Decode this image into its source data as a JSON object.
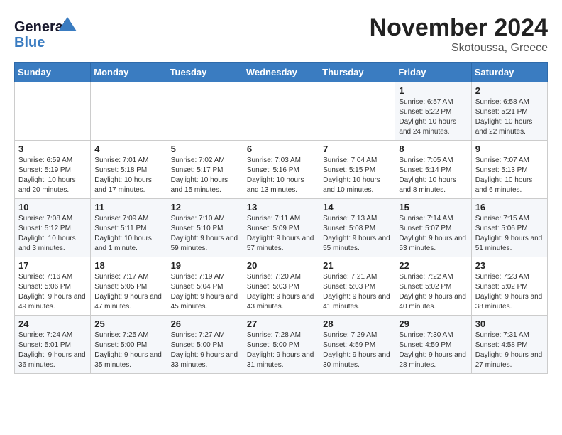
{
  "header": {
    "logo_line1": "General",
    "logo_line2": "Blue",
    "month": "November 2024",
    "location": "Skotoussa, Greece"
  },
  "weekdays": [
    "Sunday",
    "Monday",
    "Tuesday",
    "Wednesday",
    "Thursday",
    "Friday",
    "Saturday"
  ],
  "weeks": [
    [
      {
        "day": "",
        "info": ""
      },
      {
        "day": "",
        "info": ""
      },
      {
        "day": "",
        "info": ""
      },
      {
        "day": "",
        "info": ""
      },
      {
        "day": "",
        "info": ""
      },
      {
        "day": "1",
        "info": "Sunrise: 6:57 AM\nSunset: 5:22 PM\nDaylight: 10 hours and 24 minutes."
      },
      {
        "day": "2",
        "info": "Sunrise: 6:58 AM\nSunset: 5:21 PM\nDaylight: 10 hours and 22 minutes."
      }
    ],
    [
      {
        "day": "3",
        "info": "Sunrise: 6:59 AM\nSunset: 5:19 PM\nDaylight: 10 hours and 20 minutes."
      },
      {
        "day": "4",
        "info": "Sunrise: 7:01 AM\nSunset: 5:18 PM\nDaylight: 10 hours and 17 minutes."
      },
      {
        "day": "5",
        "info": "Sunrise: 7:02 AM\nSunset: 5:17 PM\nDaylight: 10 hours and 15 minutes."
      },
      {
        "day": "6",
        "info": "Sunrise: 7:03 AM\nSunset: 5:16 PM\nDaylight: 10 hours and 13 minutes."
      },
      {
        "day": "7",
        "info": "Sunrise: 7:04 AM\nSunset: 5:15 PM\nDaylight: 10 hours and 10 minutes."
      },
      {
        "day": "8",
        "info": "Sunrise: 7:05 AM\nSunset: 5:14 PM\nDaylight: 10 hours and 8 minutes."
      },
      {
        "day": "9",
        "info": "Sunrise: 7:07 AM\nSunset: 5:13 PM\nDaylight: 10 hours and 6 minutes."
      }
    ],
    [
      {
        "day": "10",
        "info": "Sunrise: 7:08 AM\nSunset: 5:12 PM\nDaylight: 10 hours and 3 minutes."
      },
      {
        "day": "11",
        "info": "Sunrise: 7:09 AM\nSunset: 5:11 PM\nDaylight: 10 hours and 1 minute."
      },
      {
        "day": "12",
        "info": "Sunrise: 7:10 AM\nSunset: 5:10 PM\nDaylight: 9 hours and 59 minutes."
      },
      {
        "day": "13",
        "info": "Sunrise: 7:11 AM\nSunset: 5:09 PM\nDaylight: 9 hours and 57 minutes."
      },
      {
        "day": "14",
        "info": "Sunrise: 7:13 AM\nSunset: 5:08 PM\nDaylight: 9 hours and 55 minutes."
      },
      {
        "day": "15",
        "info": "Sunrise: 7:14 AM\nSunset: 5:07 PM\nDaylight: 9 hours and 53 minutes."
      },
      {
        "day": "16",
        "info": "Sunrise: 7:15 AM\nSunset: 5:06 PM\nDaylight: 9 hours and 51 minutes."
      }
    ],
    [
      {
        "day": "17",
        "info": "Sunrise: 7:16 AM\nSunset: 5:06 PM\nDaylight: 9 hours and 49 minutes."
      },
      {
        "day": "18",
        "info": "Sunrise: 7:17 AM\nSunset: 5:05 PM\nDaylight: 9 hours and 47 minutes."
      },
      {
        "day": "19",
        "info": "Sunrise: 7:19 AM\nSunset: 5:04 PM\nDaylight: 9 hours and 45 minutes."
      },
      {
        "day": "20",
        "info": "Sunrise: 7:20 AM\nSunset: 5:03 PM\nDaylight: 9 hours and 43 minutes."
      },
      {
        "day": "21",
        "info": "Sunrise: 7:21 AM\nSunset: 5:03 PM\nDaylight: 9 hours and 41 minutes."
      },
      {
        "day": "22",
        "info": "Sunrise: 7:22 AM\nSunset: 5:02 PM\nDaylight: 9 hours and 40 minutes."
      },
      {
        "day": "23",
        "info": "Sunrise: 7:23 AM\nSunset: 5:02 PM\nDaylight: 9 hours and 38 minutes."
      }
    ],
    [
      {
        "day": "24",
        "info": "Sunrise: 7:24 AM\nSunset: 5:01 PM\nDaylight: 9 hours and 36 minutes."
      },
      {
        "day": "25",
        "info": "Sunrise: 7:25 AM\nSunset: 5:00 PM\nDaylight: 9 hours and 35 minutes."
      },
      {
        "day": "26",
        "info": "Sunrise: 7:27 AM\nSunset: 5:00 PM\nDaylight: 9 hours and 33 minutes."
      },
      {
        "day": "27",
        "info": "Sunrise: 7:28 AM\nSunset: 5:00 PM\nDaylight: 9 hours and 31 minutes."
      },
      {
        "day": "28",
        "info": "Sunrise: 7:29 AM\nSunset: 4:59 PM\nDaylight: 9 hours and 30 minutes."
      },
      {
        "day": "29",
        "info": "Sunrise: 7:30 AM\nSunset: 4:59 PM\nDaylight: 9 hours and 28 minutes."
      },
      {
        "day": "30",
        "info": "Sunrise: 7:31 AM\nSunset: 4:58 PM\nDaylight: 9 hours and 27 minutes."
      }
    ]
  ]
}
